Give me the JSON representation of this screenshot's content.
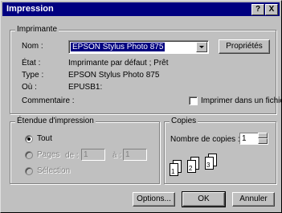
{
  "window": {
    "title": "Impression",
    "help_label": "?",
    "close_label": "X"
  },
  "printer": {
    "group_label": "Imprimante",
    "name_label": "Nom :",
    "name_value": "EPSON Stylus Photo 875",
    "properties_button": "Propriétés",
    "state_label": "État :",
    "state_value": "Imprimante par défaut ; Prêt",
    "type_label": "Type :",
    "type_value": "EPSON Stylus Photo 875",
    "where_label": "Où :",
    "where_value": "EPUSB1:",
    "comment_label": "Commentaire :",
    "print_to_file_label": "Imprimer dans un fichier"
  },
  "range": {
    "group_label": "Étendue d'impression",
    "all_label": "Tout",
    "pages_label": "Pages",
    "from_label": "de :",
    "from_value": "1",
    "to_label": "à :",
    "to_value": "1",
    "selection_label": "Sélection"
  },
  "copies": {
    "group_label": "Copies",
    "count_label": "Nombre de copies :",
    "count_value": "1",
    "page_numbers": [
      "1",
      "1",
      "2",
      "2",
      "3",
      "3"
    ]
  },
  "buttons": {
    "options": "Options...",
    "ok": "OK",
    "cancel": "Annuler"
  }
}
